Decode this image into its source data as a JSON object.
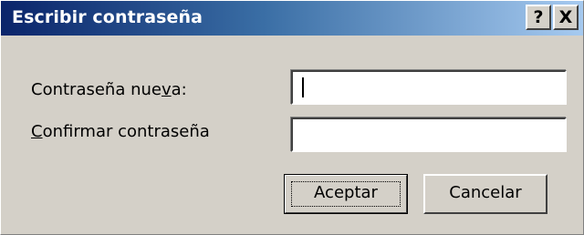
{
  "window": {
    "title": "Escribir contraseña",
    "help_label": "?",
    "close_label": "X"
  },
  "form": {
    "new_password_label_pre": "Contraseña nue",
    "new_password_label_accel": "v",
    "new_password_label_post": "a:",
    "new_password_value": "",
    "confirm_label_accel": "C",
    "confirm_label_post": "onfirmar contraseña",
    "confirm_value": ""
  },
  "buttons": {
    "ok_label": "Aceptar",
    "cancel_label": "Cancelar"
  },
  "colors": {
    "title_start": "#0a246a",
    "title_end": "#a6caf0",
    "face": "#d4d0c8"
  }
}
